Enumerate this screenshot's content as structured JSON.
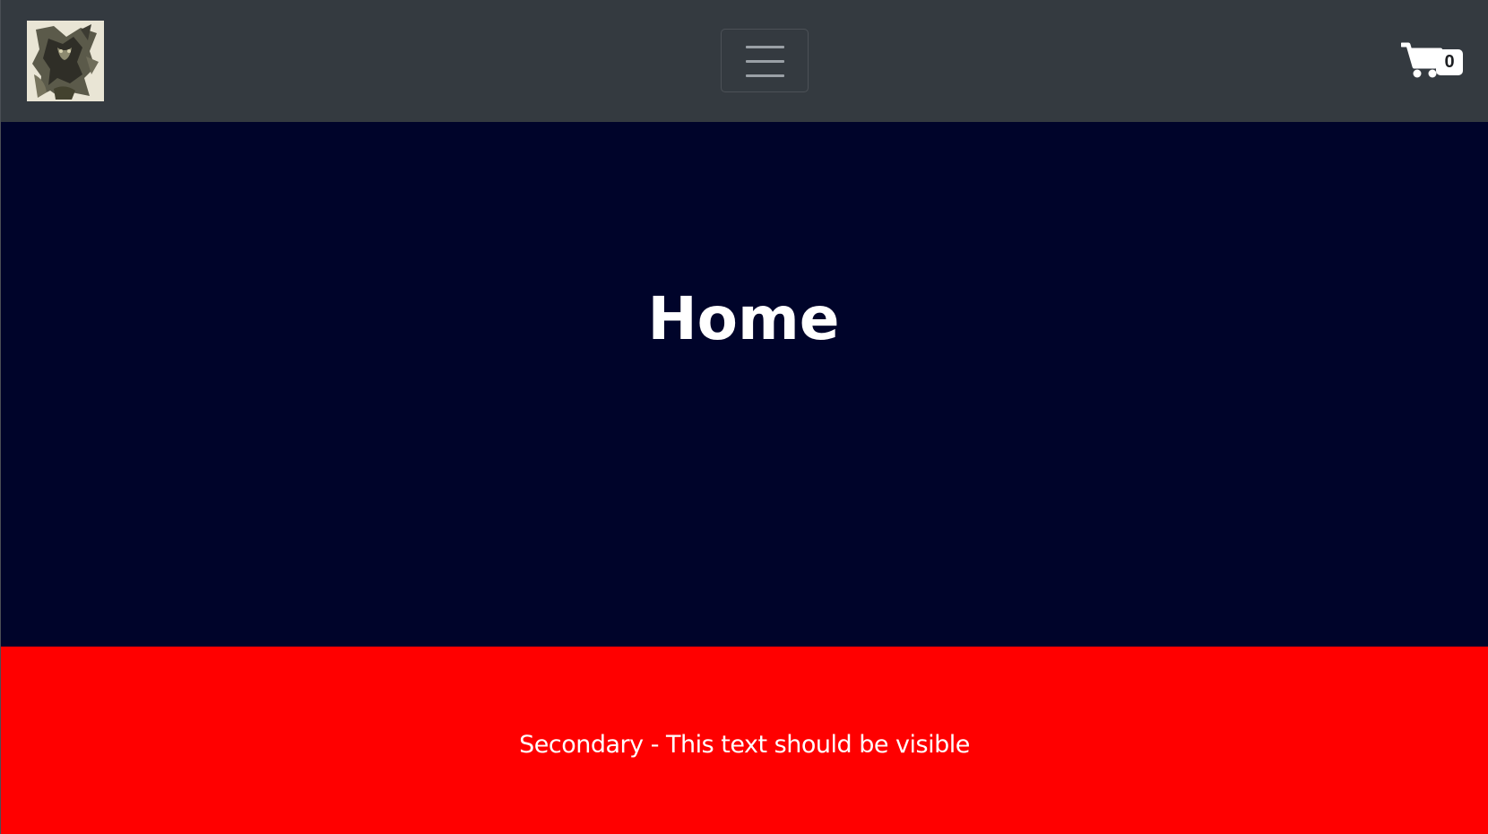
{
  "navbar": {
    "logo_icon": "gargoyle-logo-icon",
    "toggler_icon": "hamburger-menu-icon",
    "cart_icon": "shopping-cart-icon",
    "cart_count": "0",
    "background": "#343a40"
  },
  "hero": {
    "title": "Home",
    "background": "#00042a"
  },
  "secondary": {
    "text": "Secondary - This text should be visible",
    "background": "#ff0000"
  }
}
